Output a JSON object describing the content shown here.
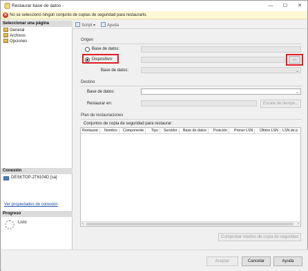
{
  "window": {
    "title": "Restaurar base de datos -",
    "minimize": "—",
    "maximize": "☐",
    "close": "✕"
  },
  "message": {
    "icon": "error-icon",
    "text": "No se seleccionó ningún conjunto de copias de seguridad para restaurarlo."
  },
  "sidebar": {
    "pages_header": "Seleccionar una página",
    "pages": [
      {
        "label": "General",
        "icon": "page-icon"
      },
      {
        "label": "Archivos",
        "icon": "page-icon"
      },
      {
        "label": "Opciones",
        "icon": "page-icon"
      }
    ],
    "connection_header": "Conexión",
    "connection_value": "DESKTOP-2T6104D [sa]",
    "connection_link": "Ver propiedades de conexión",
    "progress_header": "Progreso",
    "progress_status": "Listo"
  },
  "toolbar": {
    "script_label": "Script",
    "script_arrow": "▾",
    "help_label": "Ayuda"
  },
  "origen": {
    "group": "Origen",
    "radio_database": "Base de datos:",
    "radio_device": "Dispositivo:",
    "device_selected": true,
    "browse_button": "...",
    "database_label": "Base de datos:"
  },
  "destino": {
    "group": "Destino",
    "database_label": "Base de datos:",
    "restore_to_label": "Restaurar en:",
    "timeline_button": "Escala de tiempo..."
  },
  "plan": {
    "group": "Plan de restauraciones",
    "sets_label": "Conjuntos de copia de seguridad para restaurar:",
    "columns": [
      "Restaurar",
      "Nombre",
      "Componente",
      "Tipo",
      "Servidor",
      "Base de datos",
      "Posición",
      "Primer LSN",
      "Último LSN",
      "LSN de p"
    ],
    "verify_button": "Comprobar medios de copia de seguridad"
  },
  "footer": {
    "ok": "Aceptar",
    "cancel": "Cancelar",
    "help": "Ayuda"
  }
}
